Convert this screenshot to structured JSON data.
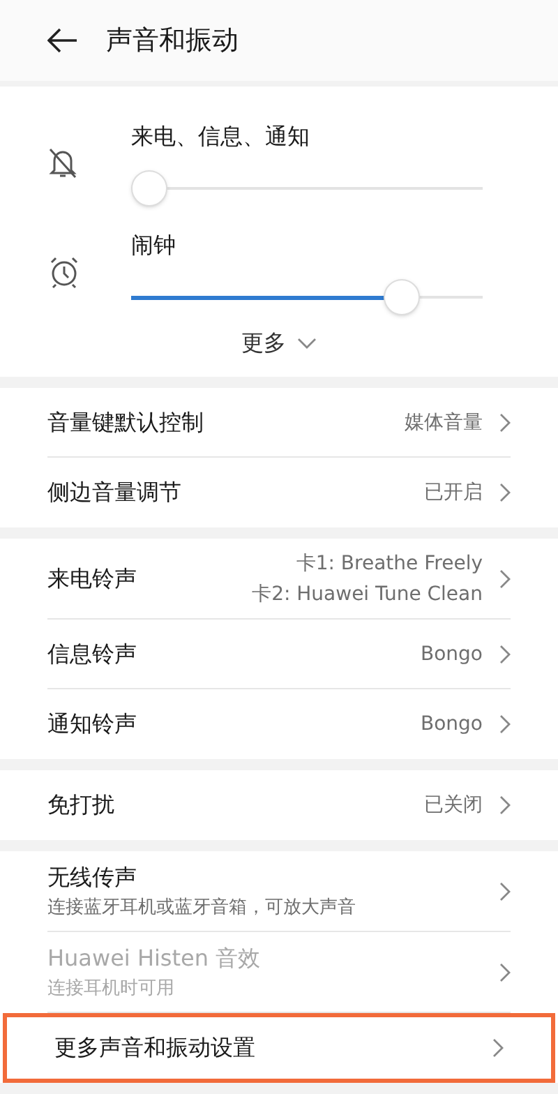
{
  "header": {
    "title": "声音和振动"
  },
  "volume": {
    "sliders": [
      {
        "kind": "muted-bell",
        "label": "来电、信息、通知",
        "level": 0
      },
      {
        "kind": "alarm",
        "label": "闹钟",
        "level": 0.8
      }
    ],
    "more": "更多"
  },
  "groups": [
    [
      {
        "title": "音量键默认控制",
        "values": [
          "媒体音量"
        ],
        "disabled": false,
        "highlighted": false
      },
      {
        "title": "侧边音量调节",
        "values": [
          "已开启"
        ],
        "disabled": false,
        "highlighted": false
      }
    ],
    [
      {
        "title": "来电铃声",
        "values": [
          "卡1: Breathe Freely",
          "卡2: Huawei Tune Clean"
        ],
        "disabled": false,
        "highlighted": false
      },
      {
        "title": "信息铃声",
        "values": [
          "Bongo"
        ],
        "disabled": false,
        "highlighted": false
      },
      {
        "title": "通知铃声",
        "values": [
          "Bongo"
        ],
        "disabled": false,
        "highlighted": false
      }
    ],
    [
      {
        "title": "免打扰",
        "values": [
          "已关闭"
        ],
        "disabled": false,
        "highlighted": false
      }
    ],
    [
      {
        "title": "无线传声",
        "subtitle": "连接蓝牙耳机或蓝牙音箱，可放大声音",
        "disabled": false,
        "highlighted": false
      },
      {
        "title": "Huawei Histen 音效",
        "subtitle": "连接耳机时可用",
        "disabled": true,
        "highlighted": false
      },
      {
        "title": "更多声音和振动设置",
        "disabled": false,
        "highlighted": true
      }
    ]
  ]
}
